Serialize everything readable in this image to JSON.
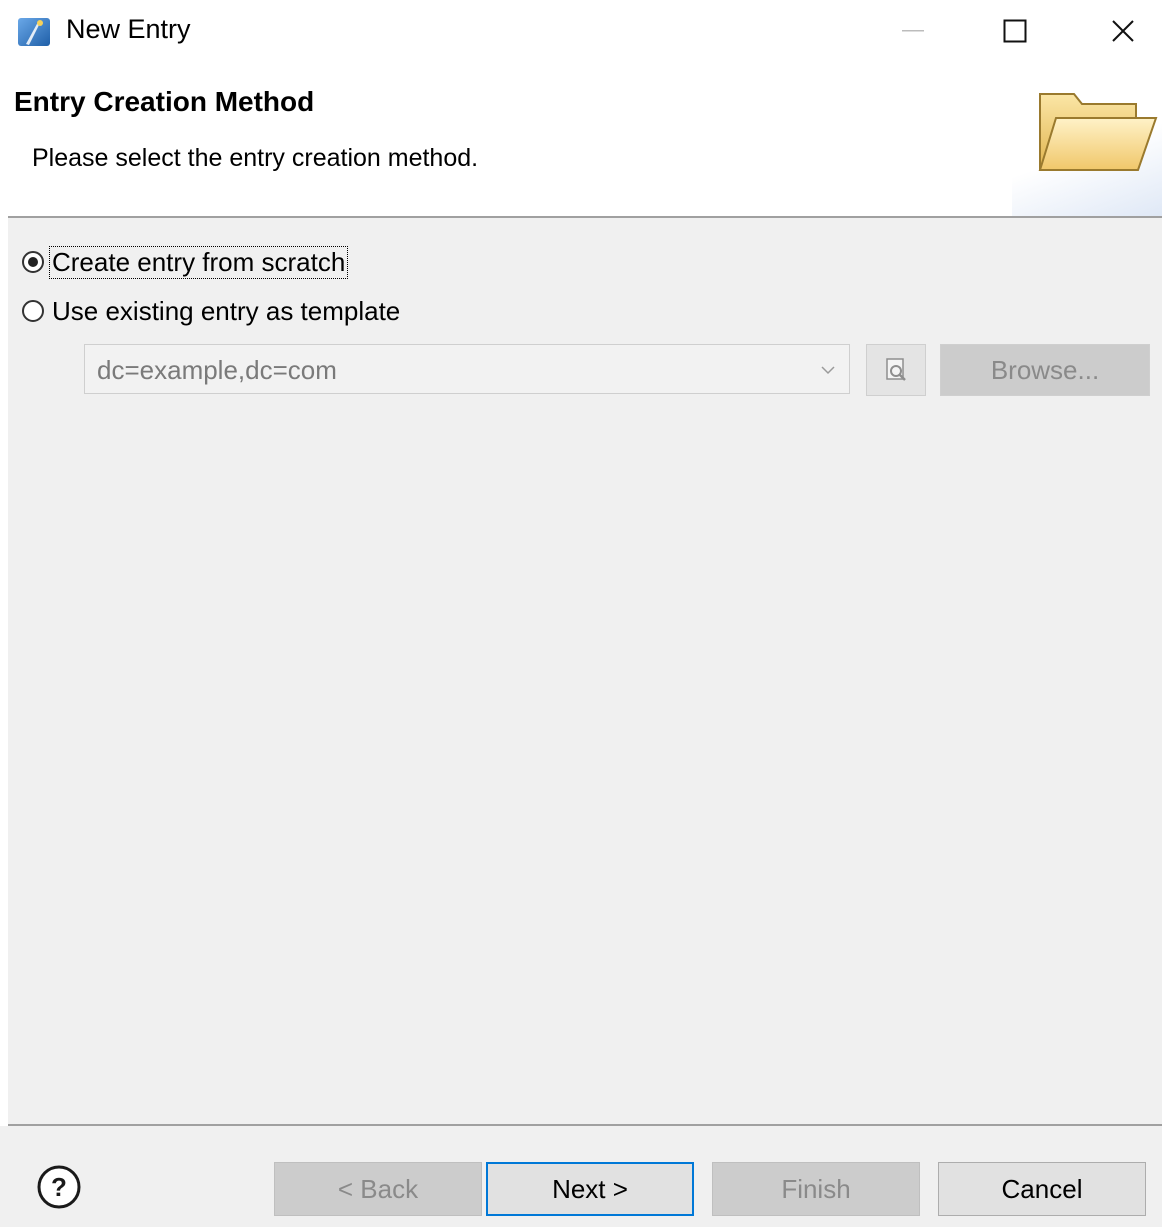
{
  "window": {
    "title": "New Entry",
    "controls": [
      "minimize-icon",
      "maximize-icon",
      "close-icon"
    ]
  },
  "header": {
    "title": "Entry Creation Method",
    "description": "Please select the entry creation method.",
    "icon": "folder-open-icon"
  },
  "options": {
    "scratch_label": "Create entry from scratch",
    "scratch_checked": true,
    "template_label": "Use existing entry as template",
    "template_checked": false
  },
  "template_picker": {
    "value": "dc=example,dc=com",
    "browse_label": "Browse...",
    "icon": "search-entry-icon",
    "enabled": false
  },
  "footer": {
    "help_icon": "help-icon",
    "back_label": "< Back",
    "next_label": "Next >",
    "finish_label": "Finish",
    "cancel_label": "Cancel"
  }
}
